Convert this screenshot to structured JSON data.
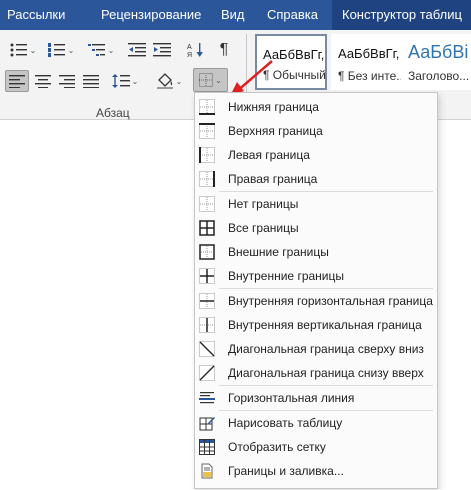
{
  "tabs": [
    {
      "label": "Рассылки"
    },
    {
      "label": "Рецензирование"
    },
    {
      "label": "Вид"
    },
    {
      "label": "Справка"
    },
    {
      "label": "Конструктор таблиц"
    }
  ],
  "ribbon": {
    "group_label": "Абзац",
    "styles": [
      {
        "preview": "АаБбВвГг,",
        "name": "¶ Обычный"
      },
      {
        "preview": "АаБбВвГг,",
        "name": "¶ Без инте..."
      },
      {
        "preview": "АаБбВі",
        "name": "Заголово..."
      }
    ],
    "pilcrow": "¶"
  },
  "menu": {
    "items": [
      {
        "label": "Нижняя граница",
        "icon": "border-bottom-icon"
      },
      {
        "label": "Верхняя граница",
        "icon": "border-top-icon"
      },
      {
        "label": "Левая граница",
        "icon": "border-left-icon"
      },
      {
        "label": "Правая граница",
        "icon": "border-right-icon"
      },
      {
        "label": "Нет границы",
        "icon": "border-none-icon"
      },
      {
        "label": "Все границы",
        "icon": "border-all-icon"
      },
      {
        "label": "Внешние границы",
        "icon": "border-outside-icon"
      },
      {
        "label": "Внутренние границы",
        "icon": "border-inside-icon"
      },
      {
        "label": "Внутренняя горизонтальная граница",
        "icon": "border-inside-horizontal-icon"
      },
      {
        "label": "Внутренняя вертикальная граница",
        "icon": "border-inside-vertical-icon"
      },
      {
        "label": "Диагональная граница сверху вниз",
        "icon": "border-diagonal-down-icon"
      },
      {
        "label": "Диагональная граница снизу вверх",
        "icon": "border-diagonal-up-icon"
      },
      {
        "label": "Горизонтальная линия",
        "icon": "horizontal-line-icon"
      },
      {
        "label": "Нарисовать таблицу",
        "icon": "draw-table-icon"
      },
      {
        "label": "Отобразить сетку",
        "icon": "view-gridlines-icon"
      },
      {
        "label": "Границы и заливка...",
        "icon": "borders-shading-icon"
      }
    ]
  },
  "colors": {
    "tab_bar": "#2b579a",
    "tab_active": "#1e4380",
    "arrow": "#e02020"
  }
}
